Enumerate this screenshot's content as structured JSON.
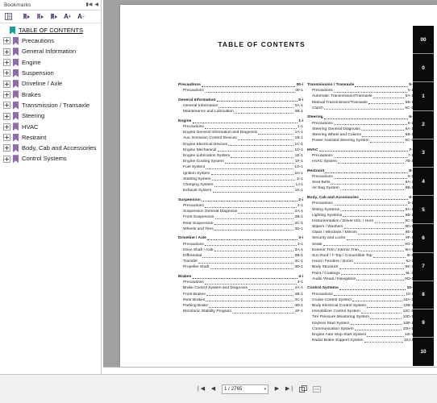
{
  "window": {
    "bookmarks_panel_title": "Bookmarks",
    "collapse_icon": "collapse-icon",
    "close_icon": "panel-close-icon"
  },
  "bookmark_toolbar": {
    "buttons": [
      {
        "name": "list-view-button",
        "glyph": "list-icon"
      },
      {
        "name": "expand-current-bookmark-button",
        "glyph": "bookmark-arrow-icon"
      },
      {
        "name": "new-bookmark-button",
        "glyph": "bookmark-arrow-icon"
      },
      {
        "name": "delete-bookmark-button",
        "glyph": "bookmark-arrow-icon"
      },
      {
        "name": "increase-text-size-button",
        "glyph": "A+"
      },
      {
        "name": "decrease-text-size-button",
        "glyph": "A-"
      }
    ]
  },
  "bookmarks": {
    "root": {
      "label": "TABLE OF CONTENTS"
    },
    "items": [
      {
        "label": "Precautions"
      },
      {
        "label": "General Information"
      },
      {
        "label": "Engine"
      },
      {
        "label": "Suspension"
      },
      {
        "label": "Driveline / Axle"
      },
      {
        "label": "Brakes"
      },
      {
        "label": "Transmission / Transaxle"
      },
      {
        "label": "Steering"
      },
      {
        "label": "HVAC"
      },
      {
        "label": "Restraint"
      },
      {
        "label": "Body, Cab and Accessories"
      },
      {
        "label": "Control Systems"
      }
    ]
  },
  "document": {
    "title": "TABLE OF CONTENTS",
    "toc_left": [
      {
        "head": {
          "title": "Precautions",
          "page": "00-i"
        },
        "subs": [
          {
            "title": "Precautions",
            "page": "00-1"
          }
        ]
      },
      {
        "head": {
          "title": "General Information",
          "page": "0-i"
        },
        "subs": [
          {
            "title": "General Information",
            "page": "0A-1"
          },
          {
            "title": "Maintenance and Lubrication",
            "page": "0B-1"
          }
        ]
      },
      {
        "head": {
          "title": "Engine",
          "page": "1-i"
        },
        "subs": [
          {
            "title": "Precautions",
            "page": "1-1"
          },
          {
            "title": "Engine General Information and Diagnosis",
            "page": "1A-1"
          },
          {
            "title": "Aux. Emission Control Devices",
            "page": "1B-1"
          },
          {
            "title": "Engine Electrical Devices",
            "page": "1C-1"
          },
          {
            "title": "Engine Mechanical",
            "page": "1D-1"
          },
          {
            "title": "Engine Lubrication System",
            "page": "1E-1"
          },
          {
            "title": "Engine Cooling System",
            "page": "1F-1"
          },
          {
            "title": "Fuel System",
            "page": "1G-1"
          },
          {
            "title": "Ignition System",
            "page": "1H-1"
          },
          {
            "title": "Starting System",
            "page": "1I-1"
          },
          {
            "title": "Charging System",
            "page": "1J-1"
          },
          {
            "title": "Exhaust System",
            "page": "1K-1"
          }
        ]
      },
      {
        "head": {
          "title": "Suspension",
          "page": "2-i"
        },
        "subs": [
          {
            "title": "Precautions",
            "page": "2-1"
          },
          {
            "title": "Suspension General Diagnosis",
            "page": "2A-1"
          },
          {
            "title": "Front Suspension",
            "page": "2B-1"
          },
          {
            "title": "Rear Suspension",
            "page": "2C-1"
          },
          {
            "title": "Wheels and Tires",
            "page": "2D-1"
          }
        ]
      },
      {
        "head": {
          "title": "Driveline / Axle",
          "page": "3-i"
        },
        "subs": [
          {
            "title": "Precautions",
            "page": "3-1"
          },
          {
            "title": "Drive Shaft / Axle",
            "page": "3A-1"
          },
          {
            "title": "Differential",
            "page": "3B-1"
          },
          {
            "title": "Transfer",
            "page": "3C-1"
          },
          {
            "title": "Propeller Shaft",
            "page": "3D-1"
          }
        ]
      },
      {
        "head": {
          "title": "Brakes",
          "page": "4-i"
        },
        "subs": [
          {
            "title": "Precautions",
            "page": "4-1"
          },
          {
            "title": "Brake Control System and Diagnosis",
            "page": "4A-1"
          },
          {
            "title": "Front Brakes",
            "page": "4B-1"
          },
          {
            "title": "Rear Brakes",
            "page": "4C-1"
          },
          {
            "title": "Parking Brake",
            "page": "4D-1"
          },
          {
            "title": "Electronic Stability Program",
            "page": "4F-1"
          }
        ]
      }
    ],
    "toc_right": [
      {
        "head": {
          "title": "Transmission / Transaxle",
          "page": "5-i"
        },
        "subs": [
          {
            "title": "Precautions",
            "page": "5-1"
          },
          {
            "title": "Automatic Transmission/Transaxle",
            "page": "5A-1"
          },
          {
            "title": "Manual Transmission/Transaxle",
            "page": "5B-1"
          },
          {
            "title": "Clutch",
            "page": "5C-1"
          }
        ]
      },
      {
        "head": {
          "title": "Steering",
          "page": "6-i"
        },
        "subs": [
          {
            "title": "Precautions",
            "page": "6-1"
          },
          {
            "title": "Steering General Diagnosis",
            "page": "6A-1"
          },
          {
            "title": "Steering Wheel and Column",
            "page": "6B-1"
          },
          {
            "title": "Power Assisted Steering System",
            "page": "6C-1"
          }
        ]
      },
      {
        "head": {
          "title": "HVAC",
          "page": "7-i"
        },
        "subs": [
          {
            "title": "Precautions",
            "page": "7-1"
          },
          {
            "title": "HVAC System",
            "page": "7B-1"
          }
        ]
      },
      {
        "head": {
          "title": "Restraint",
          "page": "8-i"
        },
        "subs": [
          {
            "title": "Precautions",
            "page": "8-1"
          },
          {
            "title": "Seat Belts",
            "page": "8A-1"
          },
          {
            "title": "Air Bag System",
            "page": "8B-1"
          }
        ]
      },
      {
        "head": {
          "title": "Body, Cab and Accessories",
          "page": "9-i"
        },
        "subs": [
          {
            "title": "Precautions",
            "page": "9-1"
          },
          {
            "title": "Wiring Systems",
            "page": "9A-1"
          },
          {
            "title": "Lighting Systems",
            "page": "9B-1"
          },
          {
            "title": "Instrumentation / Driver Info. / Horn",
            "page": "9C-1"
          },
          {
            "title": "Wipers / Washers",
            "page": "9D-1"
          },
          {
            "title": "Glass / Windows / Mirrors",
            "page": "9E-1"
          },
          {
            "title": "Security and Locks",
            "page": "9F-1"
          },
          {
            "title": "Seats",
            "page": "9G-1"
          },
          {
            "title": "Exterior Trim / Interior Trim",
            "page": "9H-1"
          },
          {
            "title": "Sun Roof / T-Top / Convertible Top",
            "page": "9I-1"
          },
          {
            "title": "Hood / Fenders / Doors",
            "page": "9J-1"
          },
          {
            "title": "Body Structure",
            "page": "9K-1"
          },
          {
            "title": "Paint / Coatings",
            "page": "9L-1"
          },
          {
            "title": "Audio Visual / Navigation",
            "page": "9O-1"
          }
        ]
      },
      {
        "head": {
          "title": "Control Systems",
          "page": "10-i"
        },
        "subs": [
          {
            "title": "Precautions",
            "page": "10-1"
          },
          {
            "title": "Cruise Control System",
            "page": "10A-1"
          },
          {
            "title": "Body Electrical Control System",
            "page": "10B-1"
          },
          {
            "title": "Immobilizer Control System",
            "page": "10C-1"
          },
          {
            "title": "Tire Pressure Monitoring System",
            "page": "10D-1"
          },
          {
            "title": "Keyless Start System",
            "page": "10E-1"
          },
          {
            "title": "Communication System",
            "page": "10H-1"
          },
          {
            "title": "Engine Auto Stop Start System",
            "page": "10I-1"
          },
          {
            "title": "Radar Brake Support System",
            "page": "10J-1"
          }
        ]
      }
    ],
    "index_tabs": [
      "00",
      "0",
      "1",
      "2",
      "3",
      "4",
      "5",
      "6",
      "7",
      "8",
      "9",
      "10"
    ]
  },
  "statusbar": {
    "first_page_label": "❘◀",
    "prev_page_label": "◀",
    "page_value": "1 / 2765",
    "page_dropdown_caret": "▾",
    "next_page_label": "▶",
    "last_page_label": "▶❘",
    "fit_page_icon": "fit-page-icon",
    "fit_width_icon": "fit-width-icon"
  }
}
